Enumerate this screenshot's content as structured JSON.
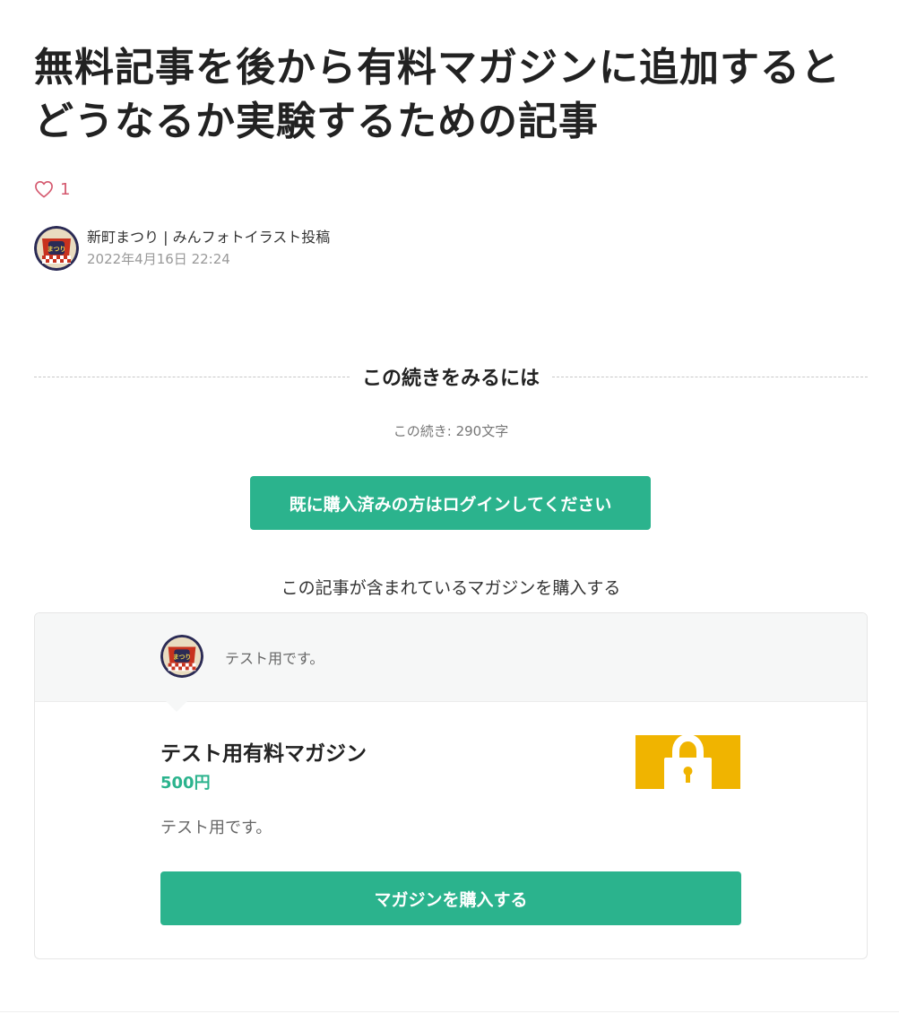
{
  "article": {
    "title": "無料記事を後から有料マガジンに追加するとどうなるか実験するための記事",
    "like_count": "1"
  },
  "author": {
    "name": "新町まつり | みんフォトイラスト投稿",
    "date": "2022年4月16日 22:24",
    "avatar_text": "まつり"
  },
  "paywall": {
    "heading": "この続きをみるには",
    "remaining": "この続き: 290文字",
    "login_label": "既に購入済みの方はログインしてください",
    "magazine_lead": "この記事が含まれているマガジンを購入する"
  },
  "magazine": {
    "header_text": "テスト用です。",
    "title": "テスト用有料マガジン",
    "price": "500円",
    "description": "テスト用です。",
    "buy_label": "マガジンを購入する"
  },
  "colors": {
    "accent": "#2bb38d",
    "like": "#d4576d",
    "thumb": "#f0b400"
  }
}
